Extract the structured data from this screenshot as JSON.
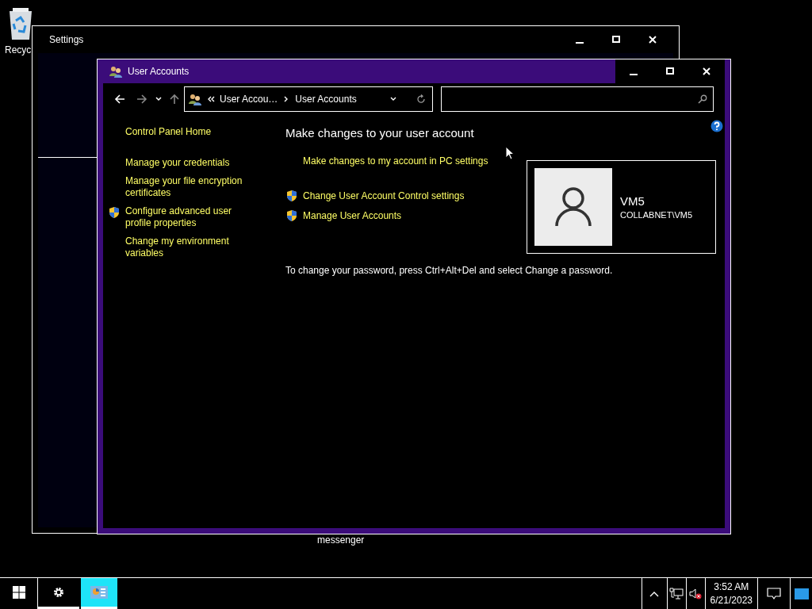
{
  "desktop_icons": [
    {
      "label": "Recyc",
      "kind": "recycle-bin"
    },
    {
      "label": "messenger",
      "kind": "label"
    }
  ],
  "settings_window": {
    "title": "Settings"
  },
  "user_accounts_window": {
    "title": "User Accounts",
    "address": {
      "crumbs": [
        "User Accou…",
        "User Accounts"
      ]
    },
    "sidebar": [
      {
        "label": "Control Panel Home",
        "shield": false
      },
      {
        "label": "Manage your credentials",
        "shield": false
      },
      {
        "label": "Manage your file encryption certificates",
        "shield": false
      },
      {
        "label": "Configure advanced user profile properties",
        "shield": true
      },
      {
        "label": "Change my environment variables",
        "shield": false
      }
    ],
    "heading": "Make changes to your user account",
    "links": [
      {
        "label": "Make changes to my account in PC settings",
        "shield": false
      },
      {
        "label": "Change User Account Control settings",
        "shield": true
      },
      {
        "label": "Manage User Accounts",
        "shield": true
      }
    ],
    "account": {
      "name": "VM5",
      "domain": "COLLABNET\\VM5"
    },
    "note": "To change your password, press Ctrl+Alt+Del and select Change a password."
  },
  "taskbar": {
    "apps": [
      {
        "kind": "settings",
        "selected": false
      },
      {
        "kind": "control-panel",
        "selected": true
      }
    ],
    "clock": {
      "time": "3:52 AM",
      "date": "6/21/2023"
    }
  }
}
